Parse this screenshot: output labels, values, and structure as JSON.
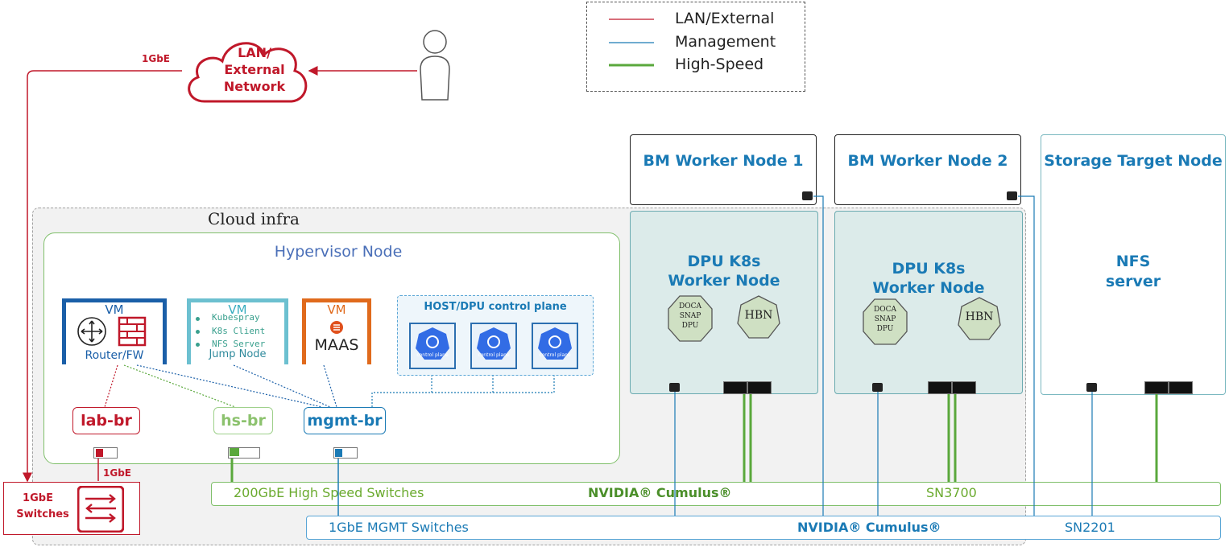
{
  "legend": {
    "lan": "LAN/External",
    "management": "Management",
    "high_speed": "High-Speed"
  },
  "colors": {
    "lan": "#c0182a",
    "management": "#1a7ab5",
    "high_speed": "#5aa83c",
    "green_text": "#6aaa2e"
  },
  "lan_network": {
    "line1": "LAN/",
    "line2": "External",
    "line3": "Network",
    "link_speed": "1GbE"
  },
  "cloud_infra": {
    "label": "Cloud infra"
  },
  "hypervisor": {
    "title": "Hypervisor Node"
  },
  "vms": {
    "router": {
      "tag": "VM",
      "label": "Router/FW"
    },
    "jump": {
      "tag": "VM",
      "items": [
        "Kubespray",
        "K8s Client",
        "NFS Server"
      ],
      "label": "Jump Node"
    },
    "maas": {
      "tag": "VM",
      "label": "MAAS"
    }
  },
  "control_plane": {
    "title": "HOST/DPU control plane",
    "icon_text": "control plane"
  },
  "bridges": {
    "lab": "lab-br",
    "hs": "hs-br",
    "mgmt": "mgmt-br"
  },
  "switch_1gbe": {
    "line1": "1GbE",
    "line2": "Switches",
    "link_speed": "1GbE"
  },
  "bm_workers": [
    {
      "title": "BM Worker Node 1"
    },
    {
      "title": "BM Worker Node 2"
    }
  ],
  "dpu_workers": [
    {
      "line1": "DPU K8s",
      "line2": "Worker Node",
      "snap": [
        "DOCA",
        "SNAP",
        "DPU"
      ],
      "hbn": "HBN"
    },
    {
      "line1": "DPU K8s",
      "line2": "Worker Node",
      "snap": [
        "DOCA",
        "SNAP",
        "DPU"
      ],
      "hbn": "HBN"
    }
  ],
  "storage": {
    "title": "Storage Target Node",
    "line1": "NFS",
    "line2": "server"
  },
  "hs_switch": {
    "label": "200GbE  High Speed Switches",
    "vendor": "NVIDIA® Cumulus®",
    "model": "SN3700"
  },
  "mgmt_switch": {
    "label": "1GbE  MGMT Switches",
    "vendor": "NVIDIA® Cumulus®",
    "model": "SN2201"
  }
}
